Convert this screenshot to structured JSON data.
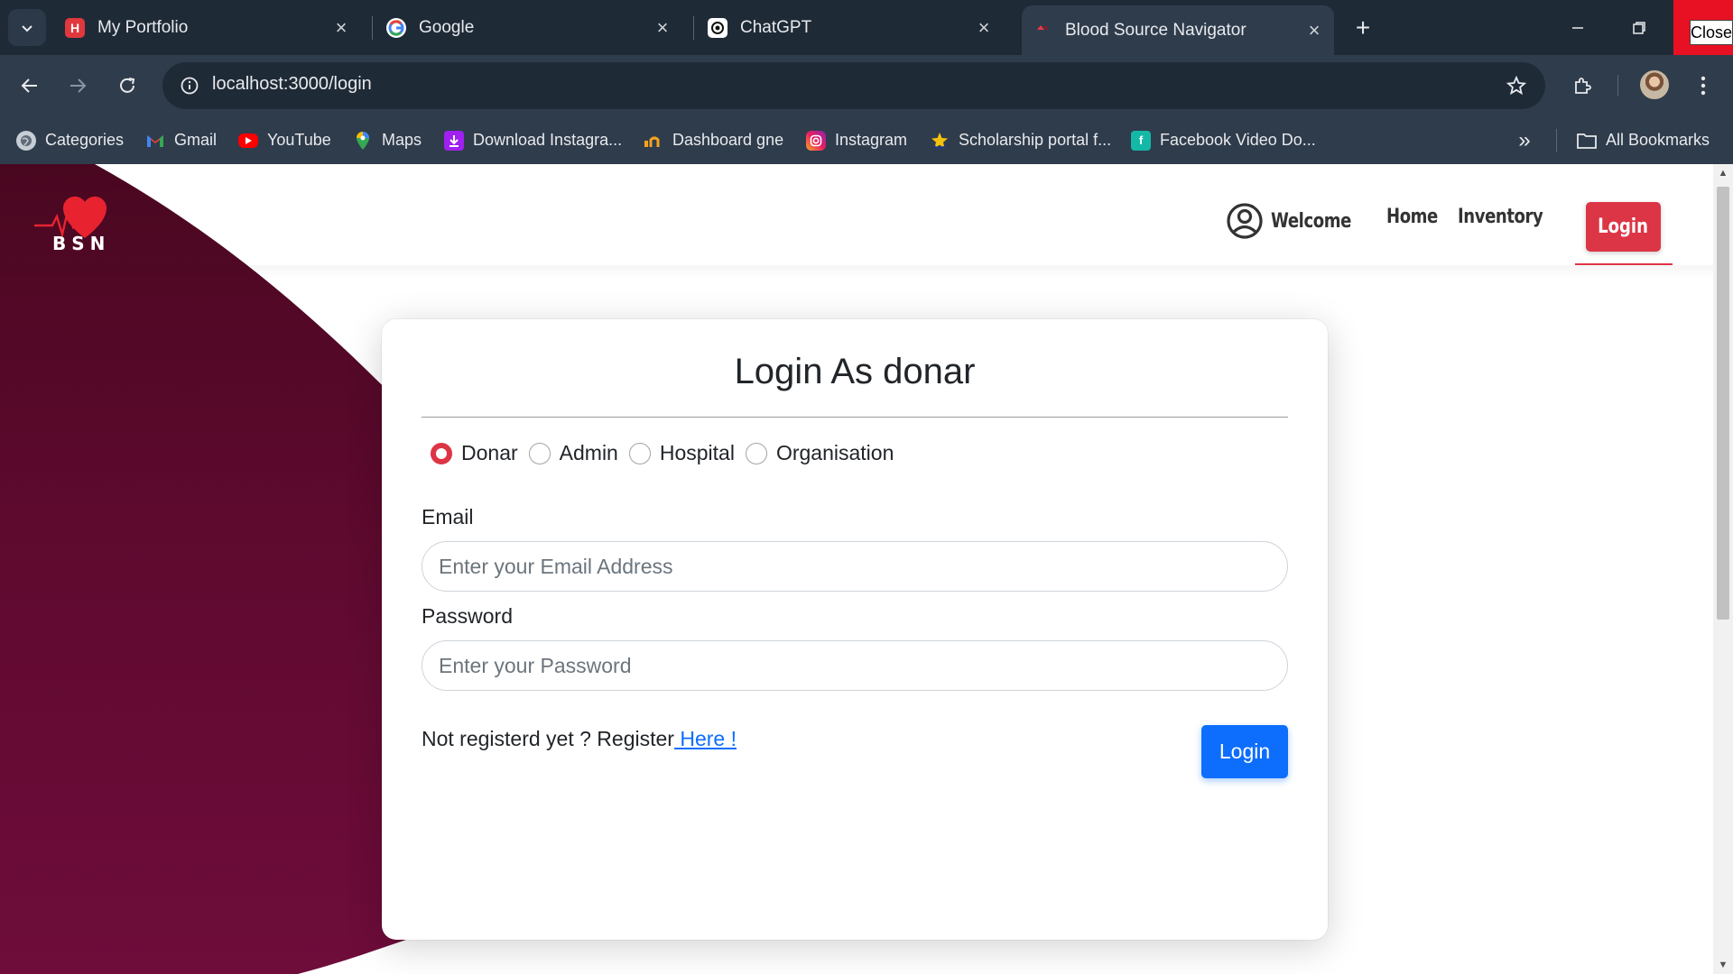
{
  "browser": {
    "tabs": [
      {
        "title": "My Portfolio",
        "icon": "portfolio-icon",
        "active": false
      },
      {
        "title": "Google",
        "icon": "google-icon",
        "active": false
      },
      {
        "title": "ChatGPT",
        "icon": "chatgpt-icon",
        "active": false
      },
      {
        "title": "Blood Source Navigator",
        "icon": "blood-drop-icon",
        "active": true
      }
    ],
    "url": "localhost:3000/login",
    "close_label": "Close",
    "bookmarks": [
      {
        "label": "Categories",
        "icon": "globe-icon"
      },
      {
        "label": "Gmail",
        "icon": "gmail-icon"
      },
      {
        "label": "YouTube",
        "icon": "youtube-icon"
      },
      {
        "label": "Maps",
        "icon": "maps-pin-icon"
      },
      {
        "label": "Download Instagra...",
        "icon": "download-icon"
      },
      {
        "label": "Dashboard gne",
        "icon": "dashboard-icon"
      },
      {
        "label": "Instagram",
        "icon": "instagram-icon"
      },
      {
        "label": "Scholarship portal f...",
        "icon": "scholarship-icon"
      },
      {
        "label": "Facebook Video Do...",
        "icon": "facebook-video-icon"
      }
    ],
    "all_bookmarks": "All Bookmarks"
  },
  "site": {
    "logo_text": "BSN",
    "nav": {
      "welcome": "Welcome",
      "home": "Home",
      "inventory": "Inventory",
      "login": "Login"
    },
    "brand_color": "#dc3545",
    "background_color": "#6b0b35"
  },
  "login_form": {
    "title": "Login As donar",
    "roles": [
      {
        "label": "Donar",
        "checked": true
      },
      {
        "label": "Admin",
        "checked": false
      },
      {
        "label": "Hospital",
        "checked": false
      },
      {
        "label": "Organisation",
        "checked": false
      }
    ],
    "email_label": "Email",
    "email_placeholder": "Enter your Email Address",
    "password_label": "Password",
    "password_placeholder": "Enter your Password",
    "register_text": "Not registerd yet ? Register",
    "register_link": " Here !",
    "submit_label": "Login",
    "accent_color": "#0d6efd"
  }
}
